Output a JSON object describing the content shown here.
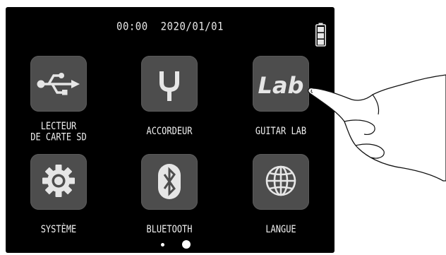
{
  "status_bar": {
    "time": "00:00",
    "date": "2020/01/01",
    "battery_icon": "battery-full-icon"
  },
  "menu": {
    "items": [
      {
        "label": "LECTEUR\nDE CARTE SD",
        "icon": "usb-icon"
      },
      {
        "label": "ACCORDEUR",
        "icon": "tuning-fork-icon"
      },
      {
        "label": "GUITAR LAB",
        "icon": "lab-logo-icon",
        "icon_text": "Lab"
      },
      {
        "label": "SYSTÈME",
        "icon": "gear-icon"
      },
      {
        "label": "BLUETOOTH",
        "icon": "bluetooth-icon"
      },
      {
        "label": "LANGUE",
        "icon": "globe-icon"
      }
    ]
  },
  "pagination": {
    "total": 2,
    "current": 2
  },
  "colors": {
    "screen_bg": "#000000",
    "tile_bg": "#4d4d4d",
    "icon": "#e6e6e6",
    "text": "#f0f0f0"
  }
}
